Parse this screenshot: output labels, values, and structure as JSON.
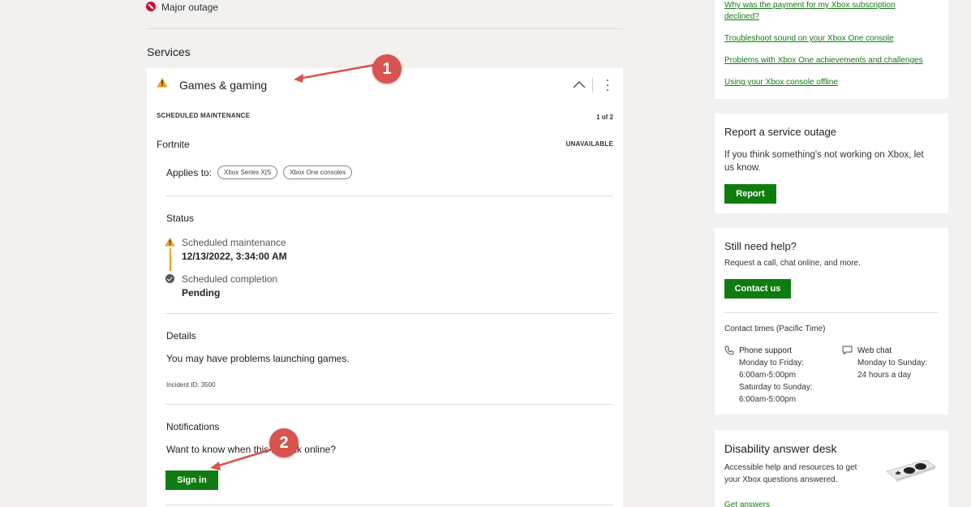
{
  "legend": {
    "label": "Major outage"
  },
  "services_heading": "Services",
  "service_card": {
    "title": "Games & gaming",
    "scheduled_label": "SCHEDULED MAINTENANCE",
    "pager": "1 of 2",
    "game_name": "Fortnite",
    "availability": "UNAVAILABLE",
    "applies_label": "Applies to:",
    "platforms": [
      "Xbox Series X|S",
      "Xbox One consoles"
    ],
    "status_label": "Status",
    "timeline": [
      {
        "title": "Scheduled maintenance",
        "value": "12/13/2022, 3:34:00 AM"
      },
      {
        "title": "Scheduled completion",
        "value": "Pending"
      }
    ],
    "details_label": "Details",
    "details_text": "You may have problems launching games.",
    "incident_id": "Incident ID: 3500",
    "notifications_label": "Notifications",
    "notifications_question": "Want to know when this is back online?",
    "sign_in_label": "Sign in"
  },
  "help_links": [
    "Why was the payment for my Xbox subscription",
    "declined?",
    "Troubleshoot sound on your Xbox One console",
    "Problems with Xbox One achievements and challenges",
    "Using your Xbox console offline"
  ],
  "report_card": {
    "title": "Report a service outage",
    "text_line1": "If you think something's not working on Xbox, let",
    "text_line2": "us know.",
    "button_label": "Report"
  },
  "help_card": {
    "title": "Still need help?",
    "text": "Request a call, chat online, and more.",
    "button_label": "Contact us",
    "contact_times_label": "Contact times (Pacific Time)",
    "phone": {
      "label": "Phone support",
      "lines": [
        "Monday to Friday:",
        "6:00am-5:00pm",
        "Saturday to Sunday:",
        "6:00am-5:00pm"
      ]
    },
    "chat": {
      "label": "Web chat",
      "lines": [
        "Monday to Sunday:",
        "24 hours a day"
      ]
    }
  },
  "disability_card": {
    "title": "Disability answer desk",
    "text_line1": "Accessible help and resources to get",
    "text_line2": "your Xbox questions answered.",
    "link": "Get answers"
  },
  "annotations": [
    "1",
    "2"
  ],
  "colors": {
    "brand_green": "#107c10",
    "warning": "#e8a020",
    "outage_red": "#c8102e",
    "annotation_red": "#d9534f"
  }
}
